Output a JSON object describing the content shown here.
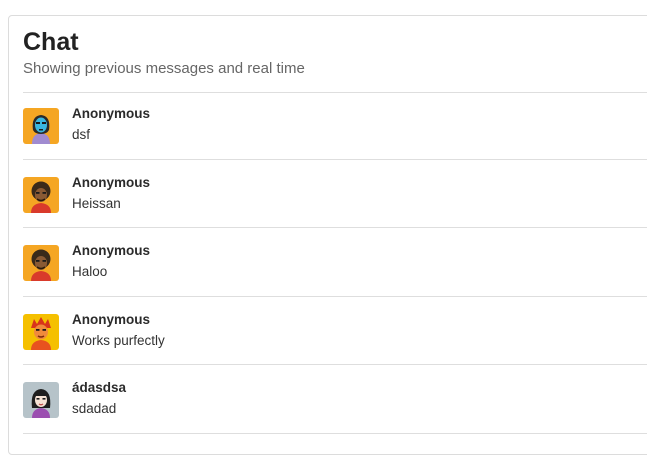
{
  "chat": {
    "title": "Chat",
    "subtitle": "Showing previous messages and real time"
  },
  "messages": [
    {
      "author": "Anonymous",
      "text": "dsf",
      "avatar": "woman-blue-face-avatar-icon"
    },
    {
      "author": "Anonymous",
      "text": "Heissan",
      "avatar": "man-afro-avatar-icon"
    },
    {
      "author": "Anonymous",
      "text": "Haloo",
      "avatar": "man-afro-avatar-icon"
    },
    {
      "author": "Anonymous",
      "text": "Works purfectly",
      "avatar": "red-hair-avatar-icon"
    },
    {
      "author": "ádasdsa",
      "text": "sdadad",
      "avatar": "woman-black-hair-avatar-icon"
    }
  ],
  "colors": {
    "avatar_bg_orange": "#f5a623",
    "avatar_bg_grey": "#b6c3c9",
    "divider": "#dedede"
  }
}
